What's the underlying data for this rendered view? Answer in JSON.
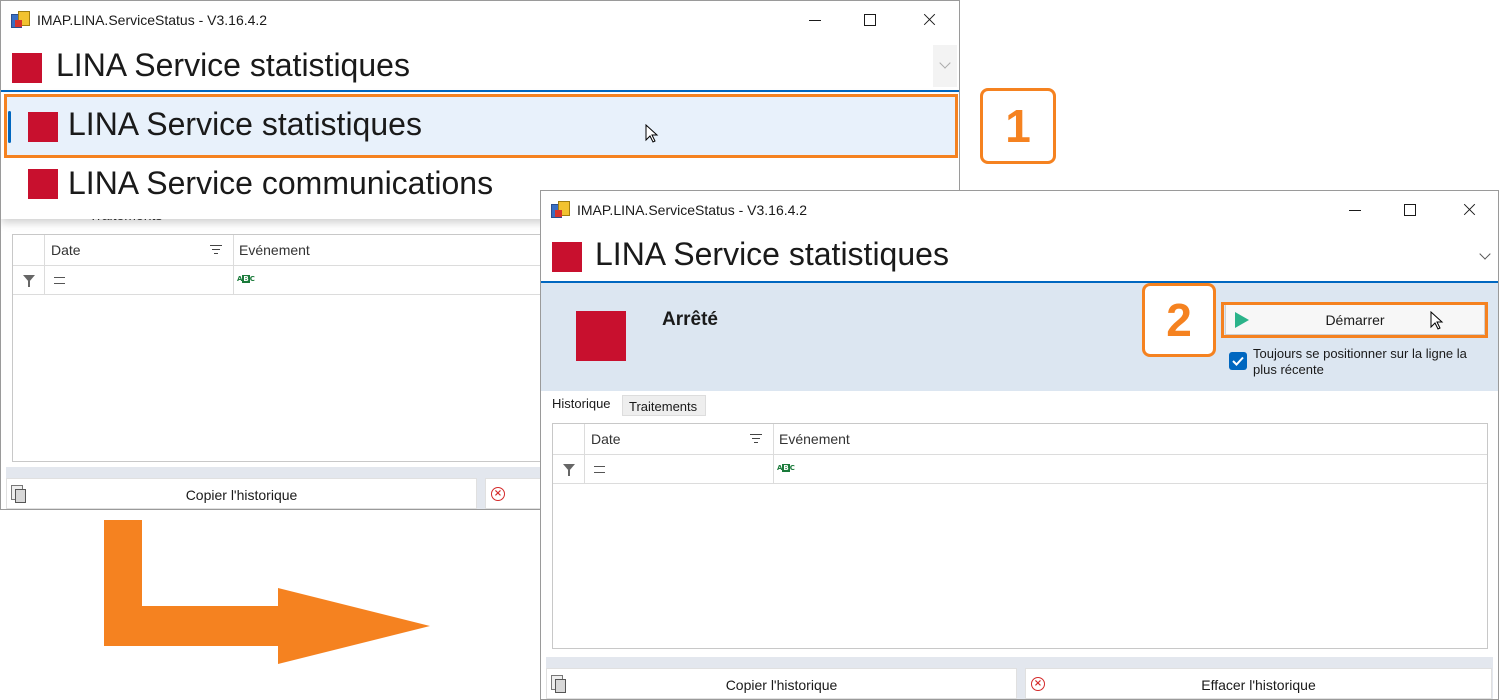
{
  "window1": {
    "title": "IMAP.LINA.ServiceStatus - V3.16.4.2",
    "selected_service": "LINA Service statistiques",
    "dropdown_items": [
      "LINA Service statistiques",
      "LINA Service communications"
    ],
    "tab_partial": "Traitements",
    "grid_columns": [
      "Date",
      "Evénement"
    ],
    "copy_button": "Copier l'historique"
  },
  "window2": {
    "title": "IMAP.LINA.ServiceStatus - V3.16.4.2",
    "selected_service": "LINA Service statistiques",
    "status_text": "Arrêté",
    "start_button": "Démarrer",
    "checkbox_label": "Toujours se positionner sur la ligne la plus récente",
    "checkbox_checked": true,
    "tabs": [
      "Historique",
      "Traitements"
    ],
    "active_tab": "Historique",
    "grid_columns": [
      "Date",
      "Evénement"
    ],
    "copy_button": "Copier l'historique",
    "clear_button": "Effacer l'historique"
  },
  "callouts": [
    "1",
    "2"
  ],
  "colors": {
    "service_stopped": "#c8102e",
    "accent_orange": "#f58220",
    "selection_blue": "#0067c0",
    "header_band": "#dce6f1"
  },
  "icons": [
    "app-icon",
    "minimize-icon",
    "maximize-icon",
    "close-icon",
    "chevron-down-icon",
    "sort-icon",
    "filter-icon",
    "equals-icon",
    "abc-icon",
    "play-icon",
    "checkbox-icon",
    "copy-icon",
    "clear-icon",
    "cursor-icon",
    "arrow-icon"
  ]
}
